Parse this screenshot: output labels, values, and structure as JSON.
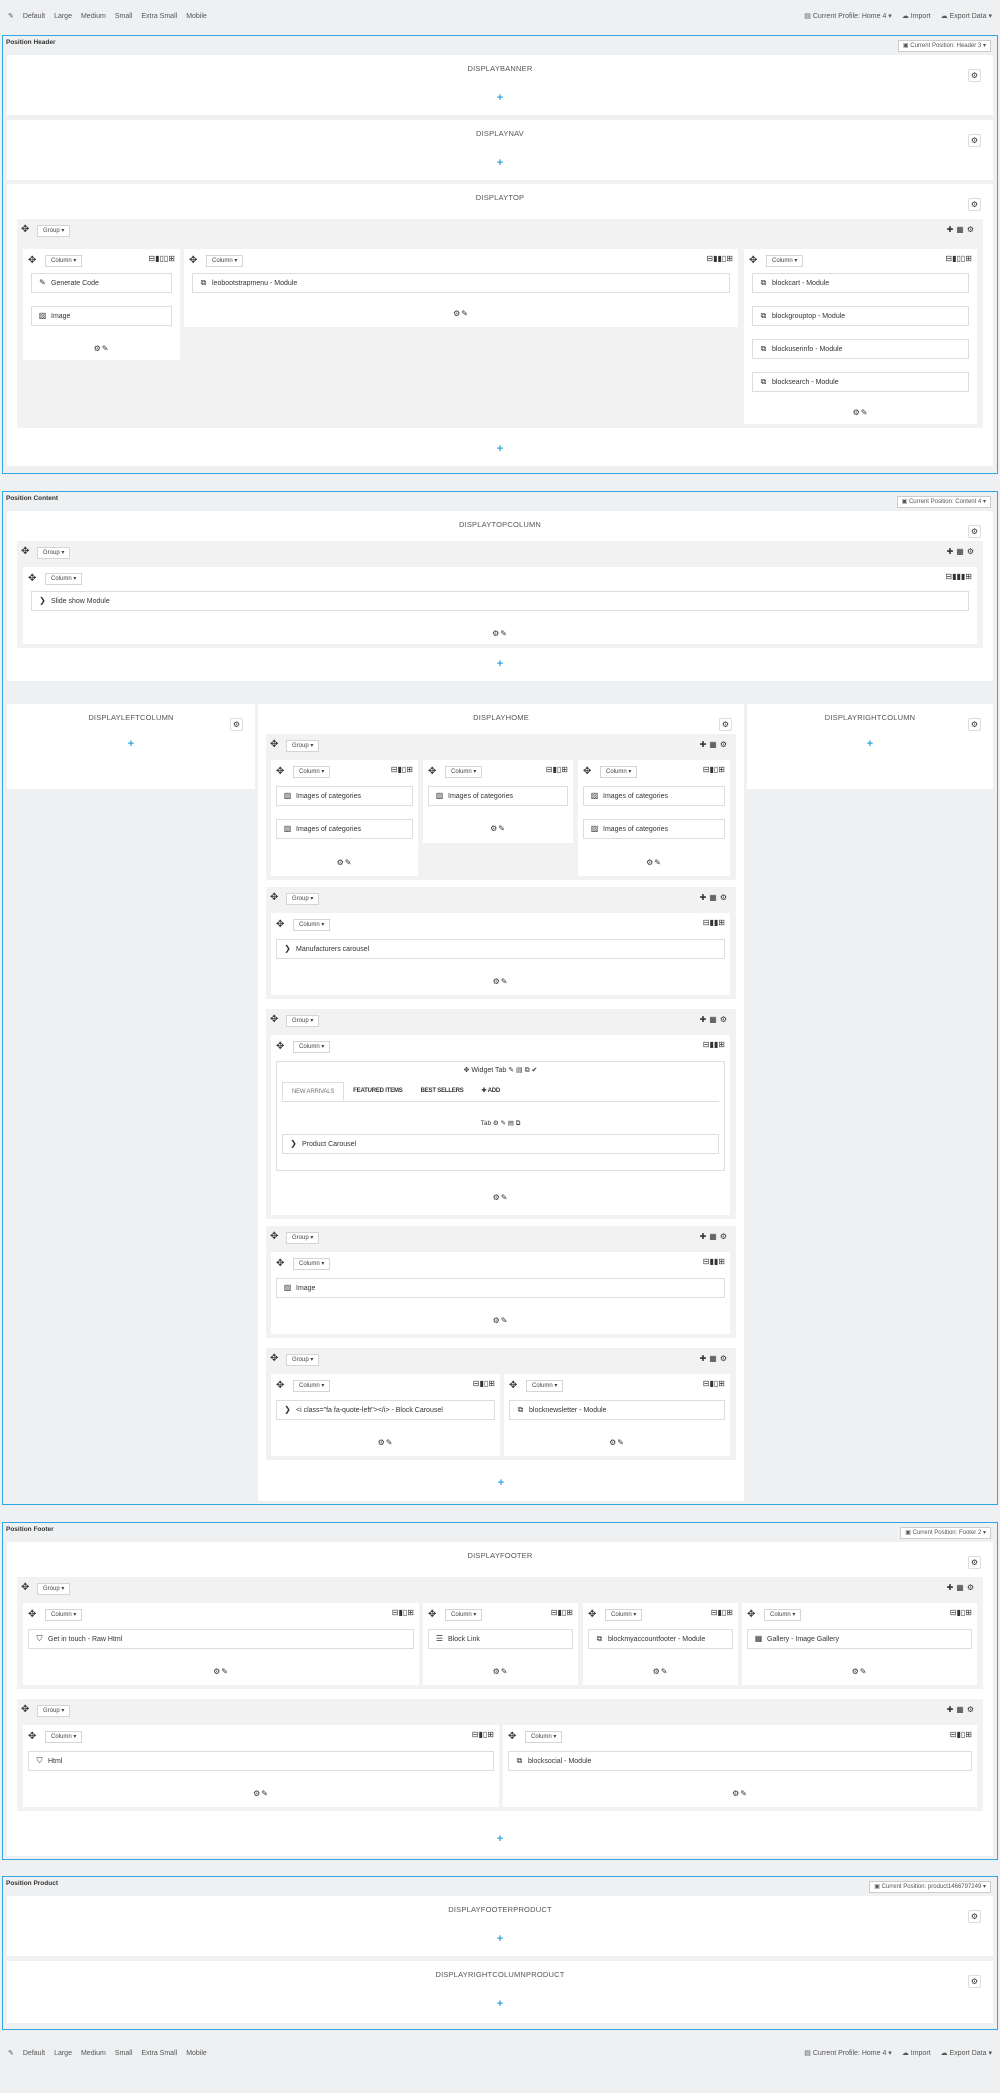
{
  "toolbar": {
    "devices": [
      "Default",
      "Large",
      "Medium",
      "Small",
      "Extra Small",
      "Mobile"
    ],
    "profile": "Current Profile: Home 4",
    "import": "Import",
    "export": "Export Data"
  },
  "positions": {
    "header": {
      "title": "Position Header",
      "selector": "Current Position: Header 3"
    },
    "content": {
      "title": "Position Content",
      "selector": "Current Position: Content 4"
    },
    "footer": {
      "title": "Position Footer",
      "selector": "Current Position: Footer 2"
    },
    "product": {
      "title": "Position Product",
      "selector": "Current Position: product1466797249"
    }
  },
  "hooks": {
    "banner": "DISPLAYBANNER",
    "nav": "DISPLAYNAV",
    "top": "DISPLAYTOP",
    "topcolumn": "DISPLAYTOPCOLUMN",
    "leftcolumn": "DISPLAYLEFTCOLUMN",
    "home": "DISPLAYHOME",
    "rightcolumn": "DISPLAYRIGHTCOLUMN",
    "footer": "DISPLAYFOOTER",
    "footerproduct": "DISPLAYFOOTERPRODUCT",
    "rightcolumnproduct": "DISPLAYRIGHTCOLUMNPRODUCT"
  },
  "labels": {
    "group": "Group",
    "column": "Column"
  },
  "modules": {
    "generate_code": "Generate Code",
    "image": "Image",
    "leobootstrapmenu": "leobootstrapmenu - Module",
    "blockcart": "blockcart - Module",
    "blockgrouptop": "blockgrouptop - Module",
    "blockuserinfo": "blockuserinfo - Module",
    "blocksearch": "blocksearch - Module",
    "slideshow": "Slide show Module",
    "images_of_categories": "Images of categories",
    "manufacturers": "Manufacturers carousel",
    "widget_tab": "Widget Tab",
    "tab_label": "Tab",
    "tabs": [
      "NEW ARRIVALS",
      "FEATURED ITEMS",
      "BEST SELLERS",
      "ADD"
    ],
    "product_carousel": "Product Carousel",
    "block_carousel": "<i class=\"fa fa-quote-left\"></i> - Block Carousel",
    "blocknewsletter": "blocknewsletter - Module",
    "get_in_touch": "Get in touch - Raw Html",
    "block_link": "Block Link",
    "blockmyaccountfooter": "blockmyaccountfooter - Module",
    "gallery": "Gallery - Image Gallery",
    "html": "Html",
    "blocksocial": "blocksocial - Module"
  }
}
